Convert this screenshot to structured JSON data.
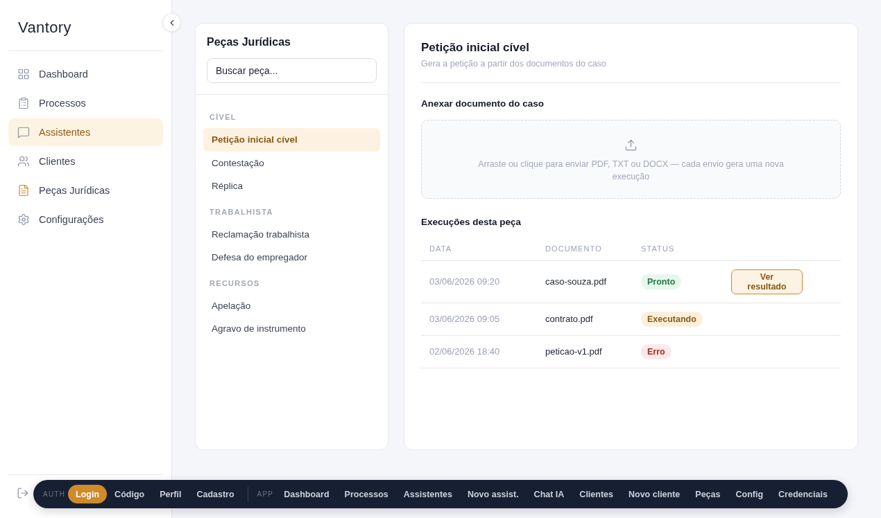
{
  "sidebar": {
    "logo": "Vantory",
    "items": [
      {
        "label": "Dashboard",
        "selected": false,
        "icon_accent": false
      },
      {
        "label": "Processos",
        "selected": false,
        "icon_accent": false
      },
      {
        "label": "Assistentes",
        "selected": true,
        "icon_accent": false
      },
      {
        "label": "Clientes",
        "selected": false,
        "icon_accent": false
      },
      {
        "label": "Peças Jurídicas",
        "selected": false,
        "icon_accent": true
      },
      {
        "label": "Configurações",
        "selected": false,
        "icon_accent": false
      }
    ]
  },
  "pieces_panel": {
    "title": "Peças Jurídicas",
    "search": {
      "placeholder": "Buscar peça..."
    },
    "groups": [
      {
        "label": "CÍVEL",
        "items": [
          {
            "label": "Petição inicial cível",
            "selected": true
          },
          {
            "label": "Contestação",
            "selected": false
          },
          {
            "label": "Réplica",
            "selected": false
          }
        ]
      },
      {
        "label": "TRABALHISTA",
        "items": [
          {
            "label": "Reclamação trabalhista",
            "selected": false
          },
          {
            "label": "Defesa do empregador",
            "selected": false
          }
        ]
      },
      {
        "label": "RECURSOS",
        "items": [
          {
            "label": "Apelação",
            "selected": false
          },
          {
            "label": "Agravo de instrumento",
            "selected": false
          }
        ]
      }
    ]
  },
  "detail": {
    "title": "Petição inicial cível",
    "subtitle": "Gera a petição a partir dos documentos do caso",
    "upload": {
      "label": "Anexar documento do caso",
      "hint": "Arraste ou clique para enviar PDF, TXT ou DOCX — cada envio gera uma nova execução"
    },
    "runs": {
      "title": "Execuções desta peça",
      "columns": [
        "DATA",
        "DOCUMENTO",
        "STATUS"
      ],
      "rows": [
        {
          "date": "03/06/2026 09:20",
          "document": "caso-souza.pdf",
          "status": {
            "label": "Pronto",
            "kind": "ready"
          },
          "action": "Ver resultado"
        },
        {
          "date": "03/06/2026 09:05",
          "document": "contrato.pdf",
          "status": {
            "label": "Executando",
            "kind": "running"
          }
        },
        {
          "date": "02/06/2026 18:40",
          "document": "peticao-v1.pdf",
          "status": {
            "label": "Erro",
            "kind": "error"
          }
        }
      ]
    }
  },
  "dev_nav": {
    "groups": [
      {
        "label": "AUTH",
        "items": [
          {
            "label": "Login",
            "selected": true
          },
          {
            "label": "Código",
            "selected": false
          },
          {
            "label": "Perfil",
            "selected": false
          },
          {
            "label": "Cadastro",
            "selected": false
          }
        ]
      },
      {
        "label": "APP",
        "items": [
          {
            "label": "Dashboard",
            "selected": false
          },
          {
            "label": "Processos",
            "selected": false
          },
          {
            "label": "Assistentes",
            "selected": false
          },
          {
            "label": "Novo assist.",
            "selected": false
          },
          {
            "label": "Chat IA",
            "selected": false
          },
          {
            "label": "Clientes",
            "selected": false
          },
          {
            "label": "Novo cliente",
            "selected": false
          },
          {
            "label": "Peças",
            "selected": false
          },
          {
            "label": "Config",
            "selected": false
          },
          {
            "label": "Credenciais",
            "selected": false
          }
        ]
      }
    ]
  }
}
